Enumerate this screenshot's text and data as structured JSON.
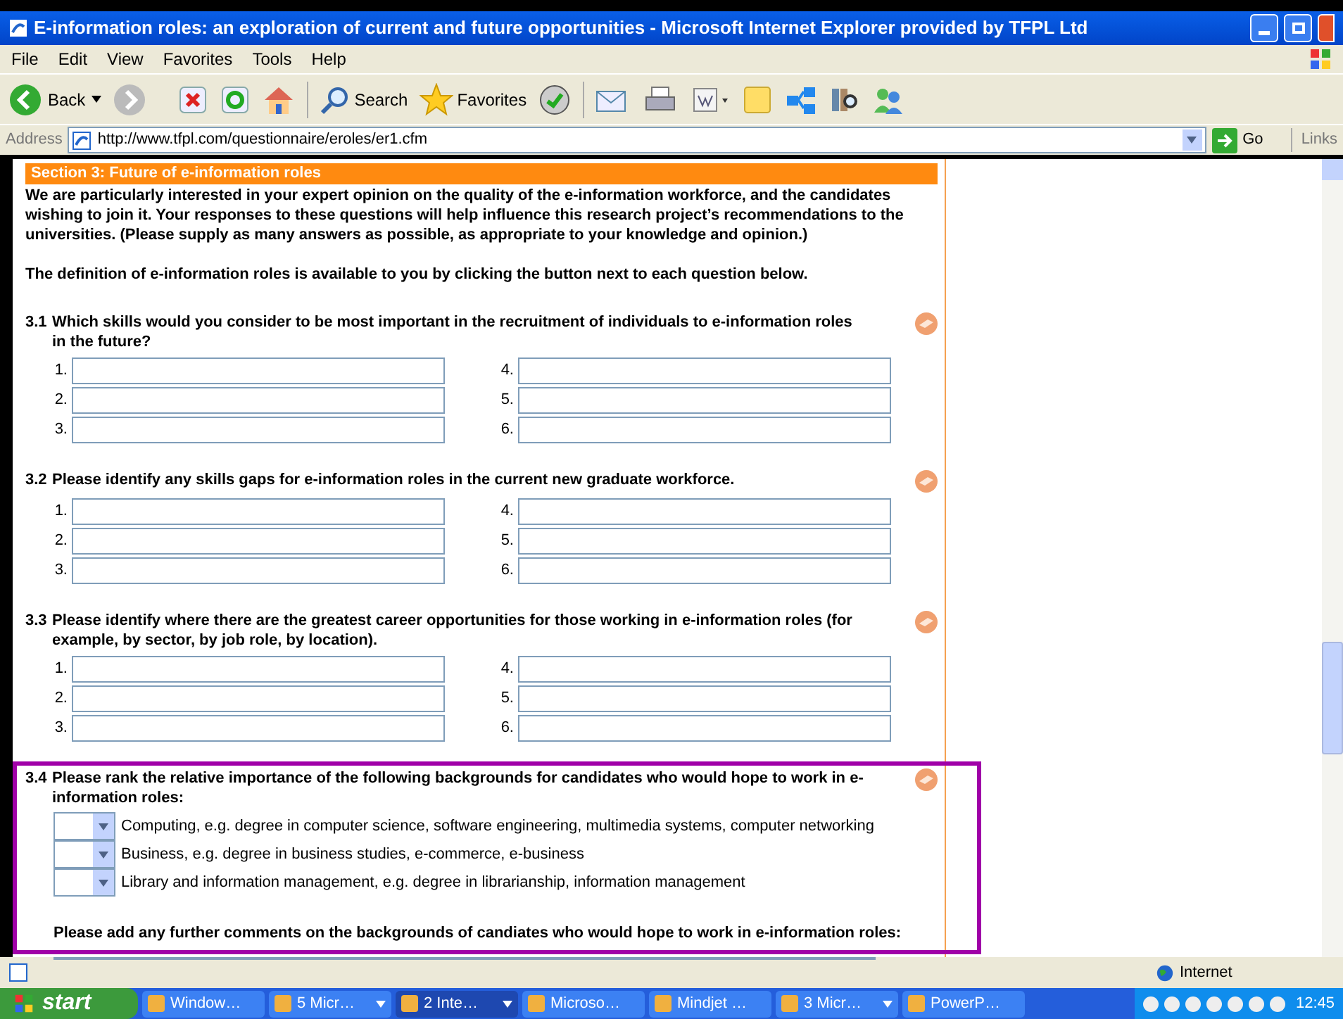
{
  "window": {
    "title": "E-information roles: an exploration of current and future opportunities - Microsoft Internet Explorer provided by TFPL Ltd"
  },
  "menu": [
    "File",
    "Edit",
    "View",
    "Favorites",
    "Tools",
    "Help"
  ],
  "toolbar": {
    "back": "Back",
    "search": "Search",
    "favorites": "Favorites"
  },
  "address": {
    "label": "Address",
    "url": "http://www.tfpl.com/questionnaire/eroles/er1.cfm",
    "go": "Go",
    "links": "Links"
  },
  "section": {
    "title": "Section 3: Future of e-information roles",
    "intro": [
      "We are particularly interested in your expert opinion on the quality of the e-information workforce, and the candidates wishing to join it. Your responses to these questions will help influence this research project’s recommendations to the universities. (Please supply as many answers as possible, as appropriate to your knowledge and opinion.)",
      "The definition of e-information roles is available to you by clicking the button next to each question below."
    ]
  },
  "questions": [
    {
      "number": "3.1",
      "text": "Which skills would you consider to be most important in the recruitment of individuals to e-information roles in the future?",
      "fields": [
        "1.",
        "4.",
        "2.",
        "5.",
        "3.",
        "6."
      ]
    },
    {
      "number": "3.2",
      "text": "Please identify any skills gaps for e-information roles in the current new graduate workforce.",
      "fields": [
        "1.",
        "4.",
        "2.",
        "5.",
        "3.",
        "6."
      ]
    },
    {
      "number": "3.3",
      "text": "Please identify where there are the greatest career opportunities for those working in e-information roles (for example, by sector, by job role, by location).",
      "fields": [
        "1.",
        "4.",
        "2.",
        "5.",
        "3.",
        "6."
      ]
    }
  ],
  "ranking": {
    "number": "3.4",
    "text": "Please rank the relative importance of the following backgrounds for candidates who would hope to work in e-information roles:",
    "items": [
      "Computing, e.g. degree in computer science, software engineering, multimedia systems, computer networking",
      "Business, e.g. degree in business studies, e-commerce, e-business",
      "Library and information management, e.g. degree in librarianship, information management"
    ],
    "comments_prompt": "Please add any further comments on the backgrounds of candiates who would hope to work in e-information roles:"
  },
  "status_bar": {
    "zone": "Internet"
  },
  "taskbar": {
    "start": "start",
    "clock": "12:45",
    "tasks": [
      {
        "label": "Window…",
        "grouped": false,
        "selected": false
      },
      {
        "label": "5 Micr…",
        "grouped": true,
        "selected": false
      },
      {
        "label": "2 Inte…",
        "grouped": true,
        "selected": true
      },
      {
        "label": "Microso…",
        "grouped": false,
        "selected": false
      },
      {
        "label": "Mindjet …",
        "grouped": false,
        "selected": false
      },
      {
        "label": "3 Micr…",
        "grouped": true,
        "selected": false
      },
      {
        "label": "PowerP…",
        "grouped": false,
        "selected": false
      }
    ]
  }
}
